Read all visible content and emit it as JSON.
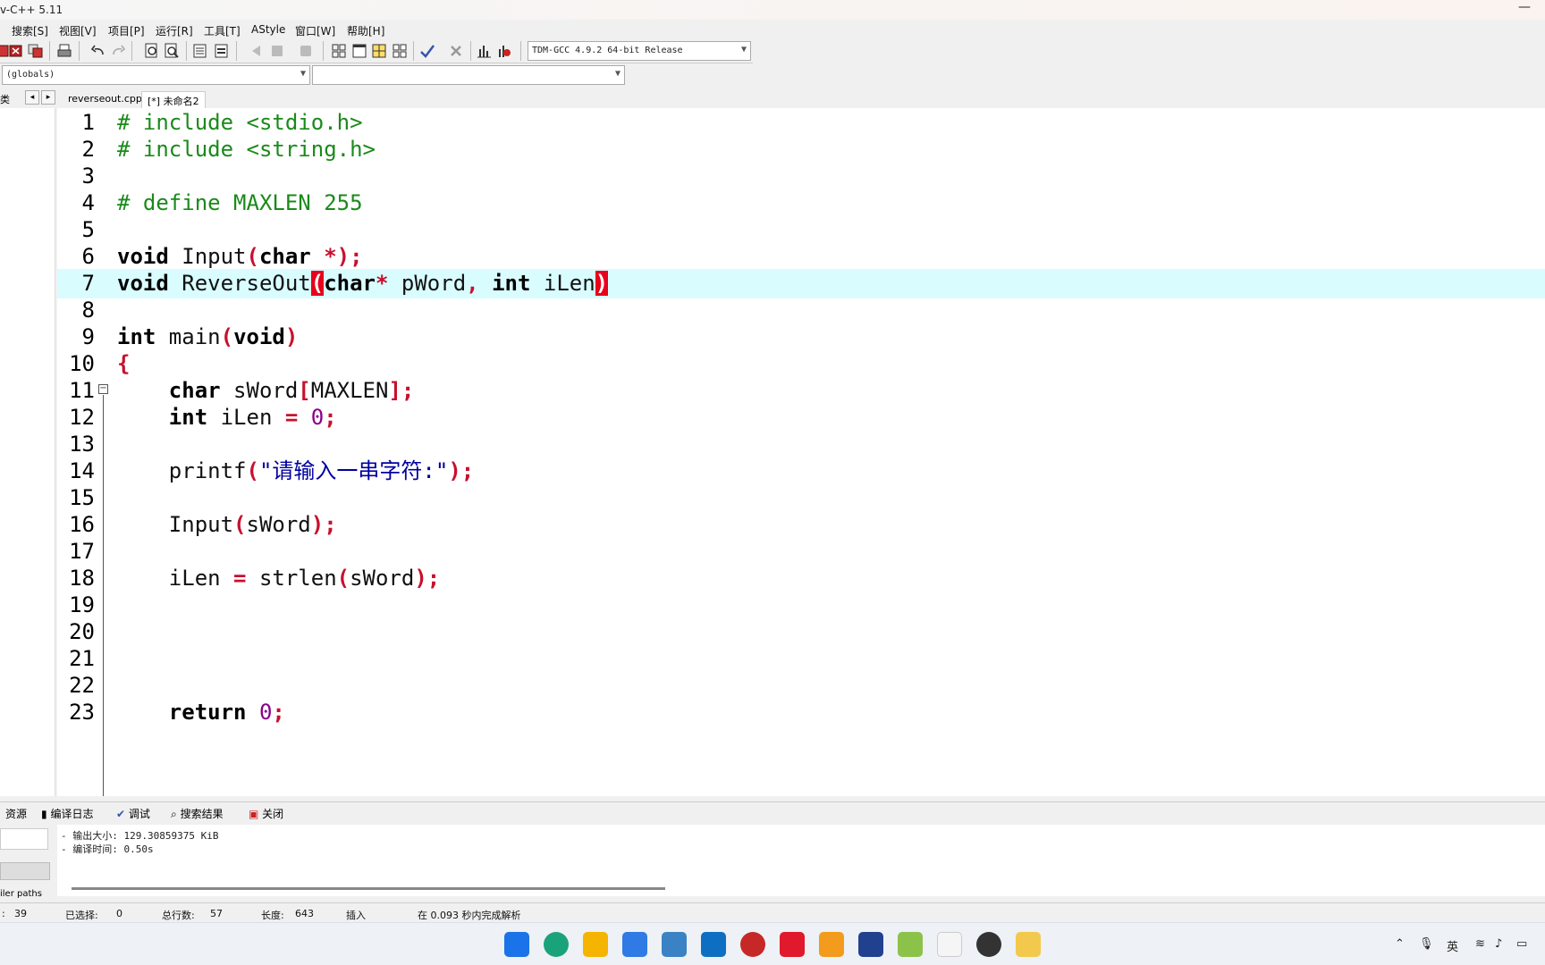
{
  "window": {
    "title": "v-C++ 5.11",
    "minimize": "—"
  },
  "menu": [
    {
      "label": "搜索[S]"
    },
    {
      "label": "视图[V]"
    },
    {
      "label": "项目[P]"
    },
    {
      "label": "运行[R]"
    },
    {
      "label": "工具[T]"
    },
    {
      "label": "AStyle"
    },
    {
      "label": "窗口[W]"
    },
    {
      "label": "帮助[H]"
    }
  ],
  "toolbar": {
    "compiler": "TDM-GCC 4.9.2 64-bit Release"
  },
  "scope": {
    "left": "(globals)",
    "right": ""
  },
  "classes_label": "类",
  "tabs": [
    {
      "label": "reverseout.cpp"
    },
    {
      "label": "[*] 未命名2"
    }
  ],
  "editor": {
    "lines": [
      {
        "n": "1"
      },
      {
        "n": "2"
      },
      {
        "n": "3"
      },
      {
        "n": "4"
      },
      {
        "n": "5"
      },
      {
        "n": "6"
      },
      {
        "n": "7"
      },
      {
        "n": "8"
      },
      {
        "n": "9"
      },
      {
        "n": "10"
      },
      {
        "n": "11"
      },
      {
        "n": "12"
      },
      {
        "n": "13"
      },
      {
        "n": "14"
      },
      {
        "n": "15"
      },
      {
        "n": "16"
      },
      {
        "n": "17"
      },
      {
        "n": "18"
      },
      {
        "n": "19"
      },
      {
        "n": "20"
      },
      {
        "n": "21"
      },
      {
        "n": "22"
      },
      {
        "n": "23"
      }
    ],
    "highlighted_line": 7
  },
  "code": {
    "l1": "# include <stdio.h>",
    "l2": "# include <string.h>",
    "l4": "# define MAXLEN 255",
    "l6_kw": "void",
    "l6_fn": " Input",
    "l6_kw2": "char",
    "l6_rest": " *",
    "l7_kw": "void",
    "l7_fn": " ReverseOut",
    "l7_kw2": "char",
    "l7_star": "*",
    "l7_arg": " pWord",
    "l7_kw3": "int",
    "l7_arg2": " iLen",
    "l9_kw": "int",
    "l9_fn": " main",
    "l9_kw2": "void",
    "l11_kw": "char",
    "l11_var": " sWord",
    "l11_mac": "MAXLEN",
    "l12_kw": "int",
    "l12_var": " iLen ",
    "l12_num": "0",
    "l14_fn": "printf",
    "l14_str": "\"请输入一串字符:\"",
    "l16_fn": "Input",
    "l16_arg": "sWord",
    "l18_var": "iLen ",
    "l18_fn": " strlen",
    "l18_arg": "sWord",
    "l23_kw": "return",
    "l23_num": "0"
  },
  "bottom_panel": {
    "tabs": [
      {
        "label": "资源"
      },
      {
        "label": "编译日志"
      },
      {
        "label": "调试"
      },
      {
        "label": "搜索结果"
      },
      {
        "label": "关闭"
      }
    ],
    "log": [
      "- 输出大小: 129.30859375 KiB",
      "- 编译时间: 0.50s"
    ],
    "side_label": "iler paths"
  },
  "status": {
    "col": ":",
    "col_val": "39",
    "selected_label": "已选择:",
    "selected_val": "0",
    "total_label": "总行数:",
    "total_val": "57",
    "length_label": "长度:",
    "length_val": "643",
    "mode": "插入",
    "parse": "在 0.093 秒内完成解析"
  },
  "taskbar": {
    "ime": "英"
  }
}
